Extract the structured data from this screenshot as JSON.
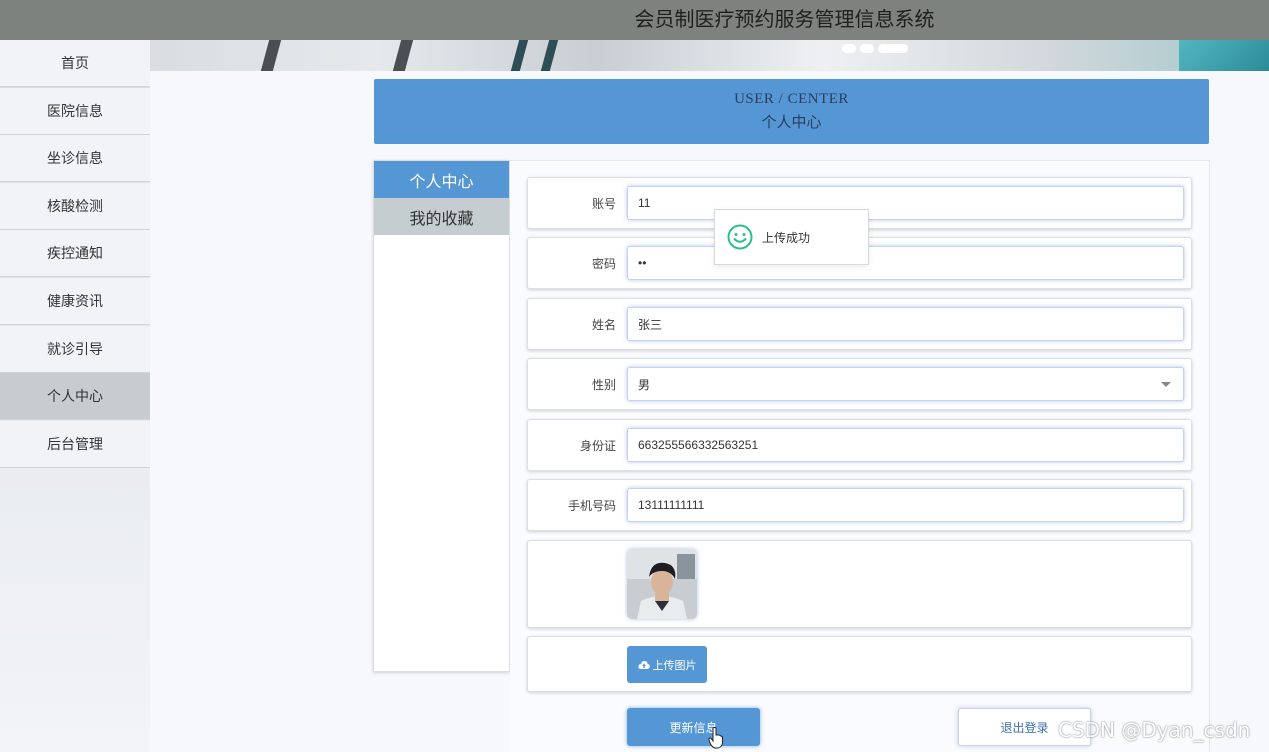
{
  "app": {
    "title": "会员制医疗预约服务管理信息系统"
  },
  "sidebar": {
    "items": [
      {
        "label": "首页"
      },
      {
        "label": "医院信息"
      },
      {
        "label": "坐诊信息"
      },
      {
        "label": "核酸检测"
      },
      {
        "label": "疾控通知"
      },
      {
        "label": "健康资讯"
      },
      {
        "label": "就诊引导"
      },
      {
        "label": "个人中心",
        "active": true
      },
      {
        "label": "后台管理"
      }
    ]
  },
  "page_header": {
    "en": "USER / CENTER",
    "cn": "个人中心"
  },
  "tabs": [
    {
      "label": "个人中心",
      "active": true
    },
    {
      "label": "我的收藏",
      "active": false
    }
  ],
  "form": {
    "account": {
      "label": "账号",
      "value": "11"
    },
    "password": {
      "label": "密码",
      "value": "••"
    },
    "name": {
      "label": "姓名",
      "value": "张三"
    },
    "gender": {
      "label": "性别",
      "value": "男"
    },
    "id_card": {
      "label": "身份证",
      "value": "663255566332563251"
    },
    "phone": {
      "label": "手机号码",
      "value": "13111111111"
    }
  },
  "upload_button": {
    "label": "上传图片",
    "icon": "cloud-upload-icon"
  },
  "update_button": {
    "label": "更新信息"
  },
  "logout_button": {
    "label": "退出登录"
  },
  "toast": {
    "message": "上传成功",
    "icon": "smile-icon"
  },
  "watermark": "CSDN @Dyan_csdn",
  "colors": {
    "accent": "#5597d4",
    "topbar": "#7d827f",
    "success": "#2fbd8f"
  }
}
